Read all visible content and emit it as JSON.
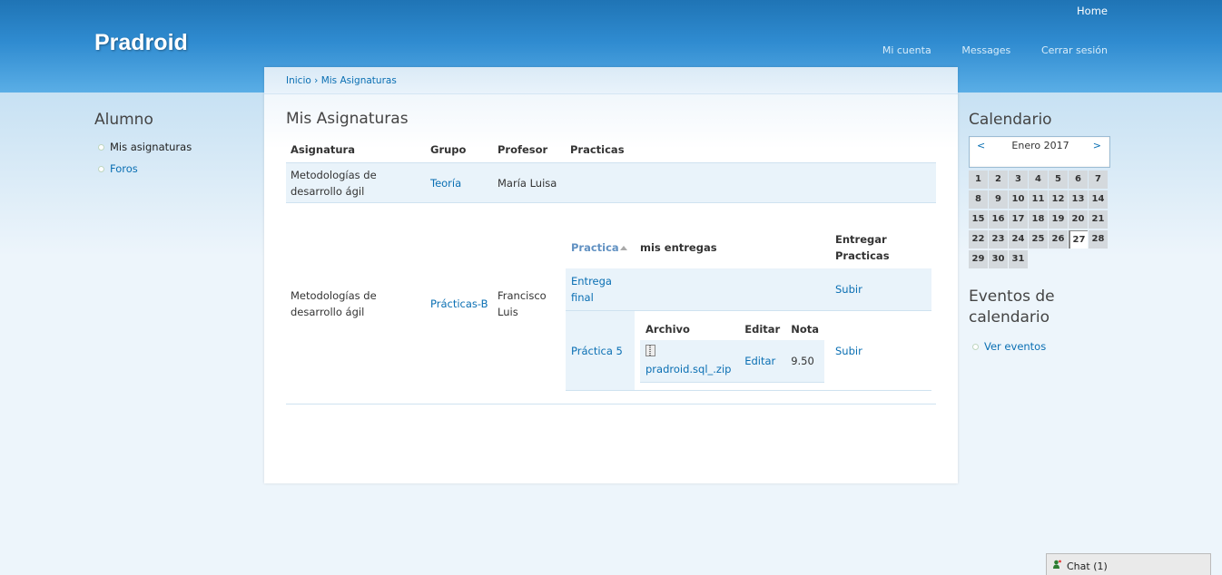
{
  "header": {
    "site_name": "Pradroid",
    "home_link": "Home",
    "links": [
      "Mi cuenta",
      "Messages",
      "Cerrar sesión"
    ]
  },
  "breadcrumb": {
    "home": "Inicio",
    "separator": "›",
    "current": "Mis Asignaturas"
  },
  "sidebar_left": {
    "title": "Alumno",
    "items": [
      "Mis asignaturas",
      "Foros"
    ]
  },
  "page_title": "Mis Asignaturas",
  "table": {
    "headers": [
      "Asignatura",
      "Grupo",
      "Profesor",
      "Practicas"
    ],
    "rows": [
      {
        "asignatura": "Metodologías de desarrollo ágil",
        "grupo": "Teoría",
        "profesor": "María Luisa"
      },
      {
        "asignatura": "Metodologías de desarrollo ágil",
        "grupo": "Prácticas-B",
        "profesor": "Francisco Luis"
      }
    ],
    "practicas": {
      "headers": [
        "Practica",
        "mis entregas",
        "Entregar Practicas"
      ],
      "rows": [
        {
          "practica": "Entrega final",
          "action": "Subir"
        },
        {
          "practica": "Práctica 5",
          "action": "Subir"
        }
      ],
      "entregas": {
        "headers": [
          "Archivo",
          "Editar",
          "Nota"
        ],
        "file": "pradroid.sql_.zip",
        "edit": "Editar",
        "nota": "9.50"
      }
    }
  },
  "sidebar_right": {
    "calendar_title": "Calendario",
    "calendar": {
      "prev": "<",
      "next": ">",
      "month": "Enero 2017",
      "today": 27,
      "days": [
        1,
        2,
        3,
        4,
        5,
        6,
        7,
        8,
        9,
        10,
        11,
        12,
        13,
        14,
        15,
        16,
        17,
        18,
        19,
        20,
        21,
        22,
        23,
        24,
        25,
        26,
        27,
        28,
        29,
        30,
        31
      ]
    },
    "events_title": "Eventos de calendario",
    "events_items": [
      "Ver eventos"
    ]
  },
  "chat": {
    "label": "Chat (1)"
  }
}
